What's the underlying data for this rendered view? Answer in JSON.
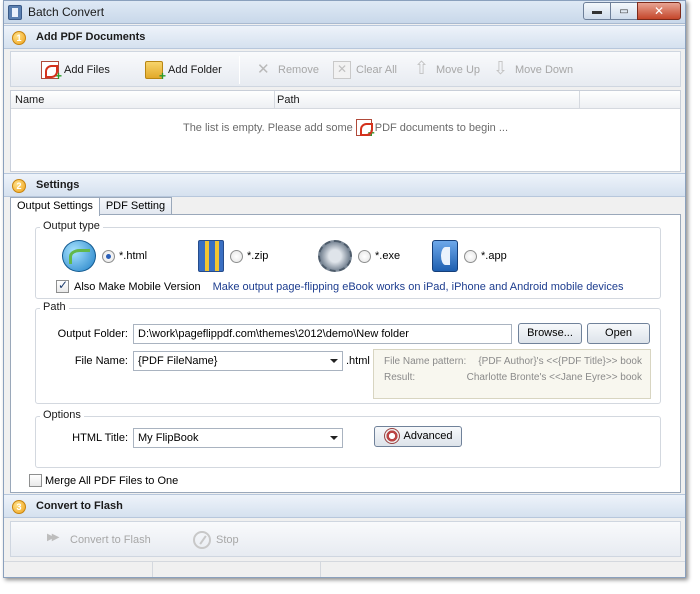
{
  "window": {
    "title": "Batch Convert",
    "controls": {
      "minimize": "▬",
      "maximize": "▭",
      "close": "✕"
    }
  },
  "sections": {
    "add_pdf": {
      "number": "1",
      "title": "Add PDF Documents"
    },
    "settings": {
      "number": "2",
      "title": "Settings"
    },
    "convert": {
      "number": "3",
      "title": "Convert to Flash"
    }
  },
  "toolbar": {
    "add_files": "Add Files",
    "add_folder": "Add Folder",
    "remove": "Remove",
    "clear_all": "Clear All",
    "move_up": "Move Up",
    "move_down": "Move Down"
  },
  "file_list": {
    "columns": [
      "Name",
      "Path"
    ],
    "empty_before": "The list is empty. Please add some",
    "empty_after": "PDF documents to begin ..."
  },
  "tabs": [
    {
      "label": "Output Settings",
      "active": true
    },
    {
      "label": "PDF Setting",
      "active": false
    }
  ],
  "output_type": {
    "group_label": "Output type",
    "options": [
      {
        "label": "*.html",
        "icon": "globe-icon",
        "selected": true
      },
      {
        "label": "*.zip",
        "icon": "zip-archive-icon",
        "selected": false
      },
      {
        "label": "*.exe",
        "icon": "gears-icon",
        "selected": false
      },
      {
        "label": "*.app",
        "icon": "mac-finder-icon",
        "selected": false
      }
    ],
    "mobile_checkbox_label": "Also Make Mobile Version",
    "mobile_checked": true,
    "mobile_hint": "Make output page-flipping eBook works on iPad, iPhone and Android mobile devices"
  },
  "path": {
    "group_label": "Path",
    "output_folder_label": "Output Folder:",
    "output_folder_value": "D:\\work\\pageflippdf.com\\themes\\2012\\demo\\New folder",
    "browse_label": "Browse...",
    "open_label": "Open",
    "file_name_label": "File Name:",
    "file_name_value": "{PDF FileName}",
    "file_ext": ".html",
    "pattern_label": "File Name pattern:",
    "pattern_value": "{PDF Author}'s <<{PDF Title}>> book",
    "result_label": "Result:",
    "result_value": "Charlotte Bronte's <<Jane Eyre>> book"
  },
  "options": {
    "group_label": "Options",
    "html_title_label": "HTML Title:",
    "html_title_value": "My FlipBook",
    "advanced_label": "Advanced"
  },
  "merge": {
    "label": "Merge All PDF Files to One",
    "checked": false
  },
  "convert": {
    "convert_label": "Convert to Flash",
    "stop_label": "Stop"
  },
  "colors": {
    "section_gradient_top": "#eef3fa",
    "section_gradient_bottom": "#d5e1ef",
    "hint_text": "#1d3d8f",
    "disabled_text": "#a7a7a7"
  }
}
